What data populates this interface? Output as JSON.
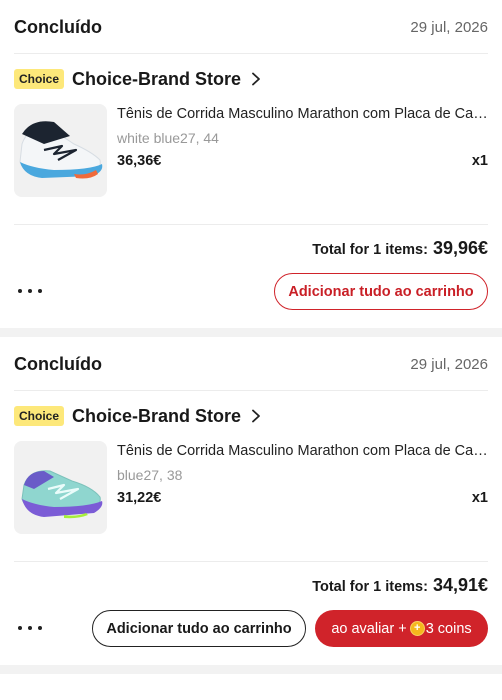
{
  "orders": [
    {
      "status": "Concluído",
      "date": "29 jul, 2026",
      "store": {
        "badge": "Choice",
        "name": "Choice-Brand Store"
      },
      "item": {
        "title": "Tênis de Corrida Masculino Marathon com Placa de Carbono",
        "variant": "white blue27, 44",
        "price": "36,36€",
        "qty": "x1"
      },
      "total": {
        "label": "Total for 1 items:",
        "value": "39,96€"
      },
      "buttons": {
        "add_all": "Adicionar tudo ao carrinho"
      },
      "colors": {
        "upper": "#f4f6f8",
        "sole": "#4aa8de",
        "accent": "#f06a3a"
      }
    },
    {
      "status": "Concluído",
      "date": "29 jul, 2026",
      "store": {
        "badge": "Choice",
        "name": "Choice-Brand Store"
      },
      "item": {
        "title": "Tênis de Corrida Masculino Marathon com Placa de Carbono",
        "variant": "blue27, 38",
        "price": "31,22€",
        "qty": "x1"
      },
      "total": {
        "label": "Total for 1 items:",
        "value": "34,91€"
      },
      "buttons": {
        "add_all": "Adicionar tudo ao carrinho",
        "review_prefix": "ao avaliar +",
        "review_coins": "3 coins"
      },
      "colors": {
        "upper": "#8fd6cf",
        "sole": "#7b5cd6",
        "accent": "#a6f03a"
      }
    }
  ],
  "icons": {
    "more": "more-dots-icon",
    "store_chevron": "chevron-right-icon",
    "coin": "coin-icon"
  },
  "theme": {
    "brand_red": "#d0232a",
    "choice_yellow": "#fde87a"
  }
}
